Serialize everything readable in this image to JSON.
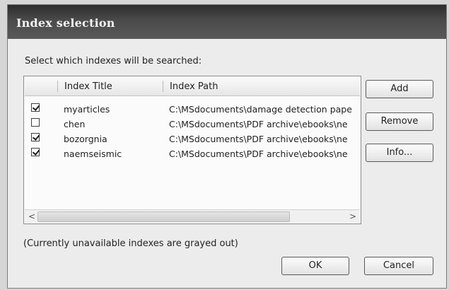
{
  "window": {
    "title": "Index selection"
  },
  "dialog": {
    "prompt": "Select which indexes will be searched:",
    "note": "(Currently unavailable indexes are grayed out)"
  },
  "list": {
    "columns": [
      "Index Title",
      "Index Path"
    ],
    "rows": [
      {
        "checked": true,
        "title": "myarticles",
        "path": "C:\\MSdocuments\\damage detection pape",
        "selected": false
      },
      {
        "checked": false,
        "title": "chen",
        "path": "C:\\MSdocuments\\PDF archive\\ebooks\\ne",
        "selected": false
      },
      {
        "checked": true,
        "title": "bozorgnia",
        "path": "C:\\MSdocuments\\PDF archive\\ebooks\\ne",
        "selected": false
      },
      {
        "checked": true,
        "title": "naemseismic",
        "path": "C:\\MSdocuments\\PDF archive\\ebooks\\ne",
        "selected": true
      }
    ],
    "scroll_left": "<",
    "scroll_right": ">"
  },
  "buttons": {
    "add": "Add",
    "remove": "Remove",
    "info": "Info...",
    "ok": "OK",
    "cancel": "Cancel"
  }
}
